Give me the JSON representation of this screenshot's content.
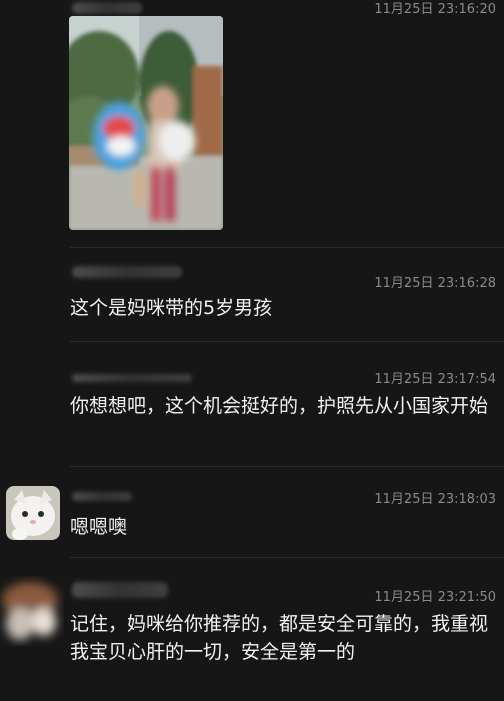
{
  "messages": [
    {
      "time": "11月25日 23:16:20"
    },
    {
      "time": "11月25日 23:16:28",
      "text": "这个是妈咪带的5岁男孩"
    },
    {
      "time": "11月25日 23:17:54",
      "text": "你想想吧，这个机会挺好的，护照先从小国家开始"
    },
    {
      "time": "11月25日 23:18:03",
      "text": "嗯嗯噢"
    },
    {
      "time": "11月25日 23:21:50",
      "text": "记住，妈咪给你推荐的，都是安全可靠的，我重视我宝贝心肝的一切，安全是第一的"
    }
  ]
}
